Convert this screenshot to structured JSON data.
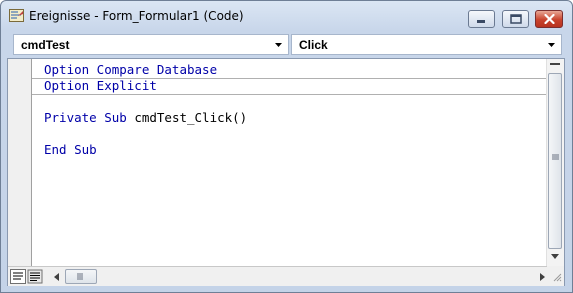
{
  "window": {
    "title": "Ereignisse - Form_Formular1 (Code)",
    "icon": "vba-module-icon",
    "buttons": [
      "minimize-icon",
      "maximize-icon",
      "close-icon"
    ]
  },
  "object_combo": {
    "value": "cmdTest"
  },
  "procedure_combo": {
    "value": "Click"
  },
  "code": {
    "line1": {
      "kw": "Option Compare Database"
    },
    "line2": {
      "kw": "Option Explicit"
    },
    "line3": {
      "kw": "Private Sub",
      "rest": " cmdTest_Click()"
    },
    "line4": {
      "kw": "End Sub"
    }
  },
  "view_buttons": [
    "procedure-view-icon",
    "full-module-view-icon"
  ],
  "colors": {
    "keyword": "#0000a8",
    "text": "#000000",
    "title_bg": "#c8d6ea",
    "close_button": "#c9432d"
  }
}
